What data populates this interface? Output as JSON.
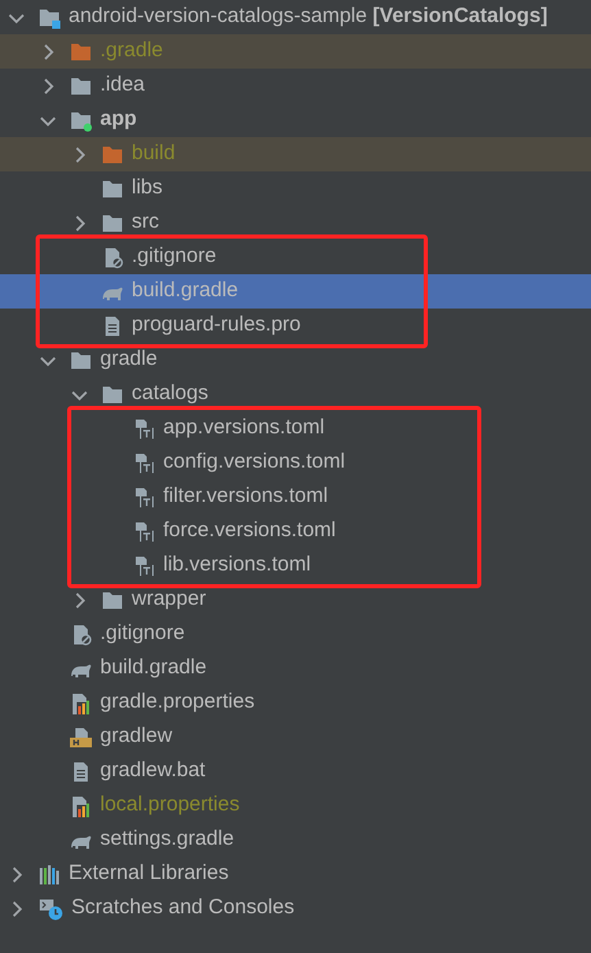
{
  "tree": [
    {
      "label": "android-version-catalogs-sample **[VersionCatalogs]**",
      "kind": "module-root",
      "expanded": true,
      "selected": false,
      "children": [
        {
          "label": ".gradle",
          "kind": "excluded-folder",
          "expanded": false,
          "ignored": true,
          "excluded": true,
          "selected": false
        },
        {
          "label": ".idea",
          "kind": "folder",
          "expanded": false,
          "selected": false
        },
        {
          "label": "app",
          "kind": "module",
          "expanded": true,
          "bold": true,
          "selected": false,
          "children": [
            {
              "label": "build",
              "kind": "excluded-folder",
              "expanded": false,
              "ignored": true,
              "excluded": true,
              "selected": false
            },
            {
              "label": "libs",
              "kind": "folder",
              "selected": false
            },
            {
              "label": "src",
              "kind": "folder",
              "expanded": false,
              "selected": false
            },
            {
              "label": ".gitignore",
              "kind": "ignore-file",
              "boxed": true,
              "selected": false
            },
            {
              "label": "build.gradle",
              "kind": "gradle",
              "boxed": true,
              "selected": true
            },
            {
              "label": "proguard-rules.pro",
              "kind": "text-file",
              "boxed": true,
              "selected": false
            }
          ]
        },
        {
          "label": "gradle",
          "kind": "folder",
          "expanded": true,
          "selected": false,
          "children": [
            {
              "label": "catalogs",
              "kind": "folder",
              "expanded": true,
              "selected": false,
              "children": [
                {
                  "label": "app.versions.toml",
                  "kind": "toml",
                  "boxed": true,
                  "selected": false
                },
                {
                  "label": "config.versions.toml",
                  "kind": "toml",
                  "boxed": true,
                  "selected": false
                },
                {
                  "label": "filter.versions.toml",
                  "kind": "toml",
                  "boxed": true,
                  "selected": false
                },
                {
                  "label": "force.versions.toml",
                  "kind": "toml",
                  "boxed": true,
                  "selected": false
                },
                {
                  "label": "lib.versions.toml",
                  "kind": "toml",
                  "boxed": true,
                  "selected": false
                }
              ]
            },
            {
              "label": "wrapper",
              "kind": "folder",
              "expanded": false,
              "selected": false
            }
          ]
        },
        {
          "label": ".gitignore",
          "kind": "ignore-file",
          "selected": false
        },
        {
          "label": "build.gradle",
          "kind": "gradle",
          "selected": false
        },
        {
          "label": "gradle.properties",
          "kind": "properties",
          "selected": false
        },
        {
          "label": "gradlew",
          "kind": "shell",
          "selected": false
        },
        {
          "label": "gradlew.bat",
          "kind": "text-file",
          "selected": false
        },
        {
          "label": "local.properties",
          "kind": "properties",
          "ignored": true,
          "selected": false
        },
        {
          "label": "settings.gradle",
          "kind": "gradle",
          "selected": false
        }
      ]
    },
    {
      "label": "External Libraries",
      "kind": "libraries",
      "expanded": false,
      "selected": false
    },
    {
      "label": "Scratches and Consoles",
      "kind": "scratches",
      "expanded": false,
      "selected": false
    }
  ]
}
